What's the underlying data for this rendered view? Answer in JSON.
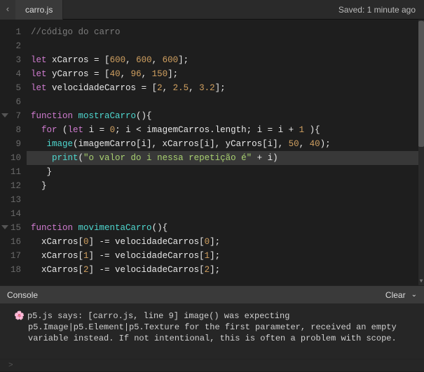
{
  "tab": {
    "arrow_glyph": "‹",
    "filename": "carro.js"
  },
  "save_status": "Saved: 1 minute ago",
  "gutter": [
    "1",
    "2",
    "3",
    "4",
    "5",
    "6",
    "7",
    "8",
    "9",
    "10",
    "11",
    "12",
    "13",
    "14",
    "15",
    "16",
    "17",
    "18"
  ],
  "code": {
    "l1_comment": "//código do carro",
    "l3_let": "let",
    "l3_name": "xCarros",
    "l3_eq": " = [",
    "l3_v1": "600",
    "l3_c1": ", ",
    "l3_v2": "600",
    "l3_c2": ", ",
    "l3_v3": "600",
    "l3_end": "];",
    "l4_let": "let",
    "l4_name": "yCarros",
    "l4_eq": " = [",
    "l4_v1": "40",
    "l4_c1": ", ",
    "l4_v2": "96",
    "l4_c2": ", ",
    "l4_v3": "150",
    "l4_end": "];",
    "l5_let": "let",
    "l5_name": "velocidadeCarros",
    "l5_eq": " = [",
    "l5_v1": "2",
    "l5_c1": ", ",
    "l5_v2": "2.5",
    "l5_c2": ", ",
    "l5_v3": "3.2",
    "l5_end": "];",
    "l7_fn": "function",
    "l7_name": "mostraCarro",
    "l7_p": "(){",
    "l8_for": "for",
    "l8_op1": " (",
    "l8_let": "let",
    "l8_i": " i = ",
    "l8_z": "0",
    "l8_sc1": "; i < imagemCarros.length; i = i + ",
    "l8_one": "1",
    "l8_end": " ){",
    "l9_img": "image",
    "l9_args_a": "(imagemCarro[i], xCarros[i], yCarros[i], ",
    "l9_50": "50",
    "l9_cm": ", ",
    "l9_40": "40",
    "l9_end": ");",
    "l10_print": "print",
    "l10_p1": "(",
    "l10_str": "\"o valor do i nessa repetição é\"",
    "l10_plus": " + i)",
    "l11_close": "}",
    "l12_close": "}",
    "l15_fn": "function",
    "l15_name": "movimentaCarro",
    "l15_p": "(){",
    "l16_a": "xCarros[",
    "l16_i": "0",
    "l16_b": "] -= velocidadeCarros[",
    "l16_i2": "0",
    "l16_c": "];",
    "l17_a": "xCarros[",
    "l17_i": "1",
    "l17_b": "] -= velocidadeCarros[",
    "l17_i2": "1",
    "l17_c": "];",
    "l18_a": "xCarros[",
    "l18_i": "2",
    "l18_b": "] -= velocidadeCarros[",
    "l18_i2": "2",
    "l18_c": "];"
  },
  "console": {
    "title": "Console",
    "clear": "Clear",
    "toggle_glyph": "⌄",
    "flower": "🌸",
    "msg": "p5.js says: [carro.js, line 9] image() was expecting p5.Image|p5.Element|p5.Texture for the first parameter, received an empty variable instead. If not intentional, this is often a problem with scope.",
    "prompt": ">"
  }
}
